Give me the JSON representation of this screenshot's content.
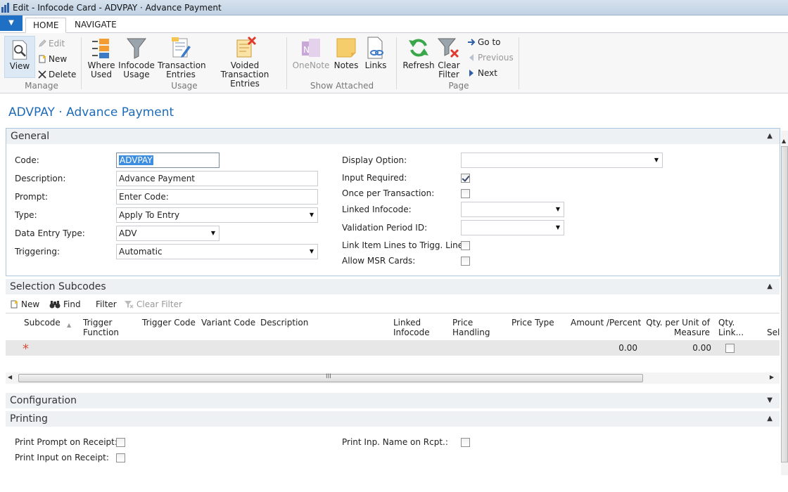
{
  "window": {
    "title": "Edit - Infocode Card - ADVPAY · Advance Payment"
  },
  "ribbon": {
    "file_glyph": "▼",
    "tabs": {
      "home": "HOME",
      "navigate": "NAVIGATE"
    },
    "manage": {
      "label": "Manage",
      "view": "View",
      "edit": "Edit",
      "new": "New",
      "delete": "Delete"
    },
    "usage": {
      "label": "Usage",
      "where_used_1": "Where",
      "where_used_2": "Used",
      "infocode_usage_1": "Infocode",
      "infocode_usage_2": "Usage",
      "transaction_entries_1": "Transaction",
      "transaction_entries_2": "Entries",
      "voided_1": "Voided",
      "voided_2": "Transaction Entries"
    },
    "attached": {
      "label": "Show Attached",
      "onenote": "OneNote",
      "notes": "Notes",
      "links": "Links"
    },
    "page": {
      "label": "Page",
      "refresh": "Refresh",
      "clear_filter_1": "Clear",
      "clear_filter_2": "Filter",
      "goto": "Go to",
      "previous": "Previous",
      "next": "Next"
    }
  },
  "page_title": "ADVPAY · Advance Payment",
  "general": {
    "header": "General",
    "code_label": "Code:",
    "code_value": "ADVPAY",
    "description_label": "Description:",
    "description_value": "Advance Payment",
    "prompt_label": "Prompt:",
    "prompt_value": "Enter Code:",
    "type_label": "Type:",
    "type_value": "Apply To Entry",
    "data_entry_type_label": "Data Entry Type:",
    "data_entry_type_value": "ADV",
    "triggering_label": "Triggering:",
    "triggering_value": "Automatic",
    "display_option_label": "Display Option:",
    "display_option_value": "",
    "input_required_label": "Input Required:",
    "input_required": true,
    "once_per_transaction_label": "Once per Transaction:",
    "once_per_transaction": false,
    "linked_infocode_label": "Linked Infocode:",
    "linked_infocode_value": "",
    "validation_period_label": "Validation Period ID:",
    "validation_period_value": "",
    "link_item_lines_label": "Link Item Lines to Trigg. Line:",
    "link_item_lines": false,
    "allow_msr_label": "Allow MSR Cards:",
    "allow_msr": false
  },
  "subcodes": {
    "header": "Selection Subcodes",
    "toolbar": {
      "new": "New",
      "find": "Find",
      "filter": "Filter",
      "clear_filter": "Clear Filter"
    },
    "columns": {
      "subcode": "Subcode",
      "trigger_function_1": "Trigger",
      "trigger_function_2": "Function",
      "trigger_code": "Trigger Code",
      "variant_code": "Variant Code",
      "description": "Description",
      "linked_infocode_1": "Linked",
      "linked_infocode_2": "Infocode",
      "price_handling_1": "Price",
      "price_handling_2": "Handling",
      "price_type": "Price Type",
      "amount_percent": "Amount /Percent",
      "qty_per_unit_1": "Qty. per Unit of",
      "qty_per_unit_2": "Measure",
      "qty_link_1": "Qty.",
      "qty_link_2": "Link...",
      "select": "Sele"
    },
    "new_row": {
      "marker": "*",
      "amount_percent": "0.00",
      "qty_per_unit": "0.00",
      "qty_link": false
    },
    "scroll_grip": "III"
  },
  "configuration": {
    "header": "Configuration"
  },
  "printing": {
    "header": "Printing",
    "print_prompt_label": "Print Prompt on Receipt:",
    "print_prompt": false,
    "print_input_label": "Print Input on Receipt:",
    "print_input": false,
    "print_inp_name_label": "Print Inp. Name on Rcpt.:",
    "print_inp_name": false
  },
  "glyphs": {
    "expanded": "▲",
    "collapsed": "▼",
    "dropdown": "▼",
    "scroll_left": "◀",
    "scroll_right": "▶",
    "scroll_up": "▲",
    "sort_asc": "▲"
  }
}
